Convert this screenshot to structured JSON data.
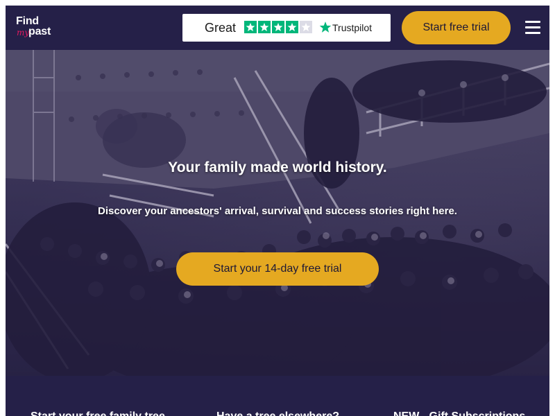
{
  "header": {
    "logo": {
      "line1": "Find",
      "line2": "my",
      "line3": "past"
    },
    "trustpilot": {
      "rating_label": "Great",
      "stars_filled": 4,
      "stars_total": 5,
      "brand": "Trustpilot",
      "star_color": "#00b67a",
      "star_icon": "star-icon"
    },
    "cta_label": "Start free trial",
    "menu_icon": "hamburger-menu-icon"
  },
  "hero": {
    "heading": "Your family made world history.",
    "subheading": "Discover your ancestors' arrival, survival and success stories right here.",
    "cta_label": "Start your 14-day free trial",
    "background": "historical-photo-ship-passengers"
  },
  "bottom_links": [
    {
      "label": "Start your free family tree"
    },
    {
      "label": "Have a tree elsewhere?"
    },
    {
      "label": "NEW - Gift Subscriptions"
    }
  ],
  "colors": {
    "brand_navy": "#252048",
    "accent_gold": "#e5a921",
    "logo_pink": "#e5185e",
    "trustpilot_green": "#00b67a"
  }
}
